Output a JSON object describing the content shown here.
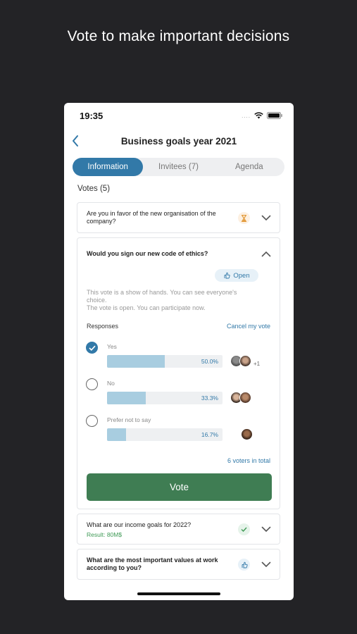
{
  "headline": "Vote to make important decisions",
  "status_bar": {
    "time": "19:35",
    "signal": "....",
    "wifi_icon": "wifi-icon",
    "battery_icon": "battery-icon"
  },
  "nav": {
    "back_icon": "back-chevron-icon",
    "title": "Business goals year 2021"
  },
  "tabs": [
    {
      "label": "Information",
      "active": true
    },
    {
      "label": "Invitees (7)",
      "active": false
    },
    {
      "label": "Agenda",
      "active": false
    }
  ],
  "votes_label": "Votes (5)",
  "cards": {
    "card1": {
      "question": "Are you in favor of the new organisation of the company?",
      "status_icon": "hourglass-icon",
      "status_color": "#e29a3a"
    },
    "card2": {
      "question": "Would you sign our new code of ethics?",
      "badge": "Open",
      "badge_icon": "hand-icon",
      "description": [
        "This vote is a show of hands. You can see everyone's choice.",
        "The vote is open. You can participate now."
      ],
      "responses_label": "Responses",
      "cancel_label": "Cancel my vote",
      "options": [
        {
          "label": "Yes",
          "percent": 50.0,
          "percent_label": "50.0%",
          "checked": true,
          "more": "+1"
        },
        {
          "label": "No",
          "percent": 33.3,
          "percent_label": "33.3%",
          "checked": false,
          "more": ""
        },
        {
          "label": "Prefer not to say",
          "percent": 16.7,
          "percent_label": "16.7%",
          "checked": false,
          "more": ""
        }
      ],
      "total_voters": "6 voters in total",
      "vote_button": "Vote"
    },
    "card3": {
      "question": "What are our income goals for 2022?",
      "result": "Result: 80M$",
      "status_icon": "check-icon",
      "status_color": "#3f9a56"
    },
    "card4": {
      "question": "What are the most important values at work according to you?",
      "status_icon": "hand-icon",
      "status_color": "#3279a8"
    }
  },
  "colors": {
    "accent": "#3279a8",
    "vote_button": "#3f7d53",
    "bar_fill": "#a8cde0",
    "background": "#232326"
  }
}
